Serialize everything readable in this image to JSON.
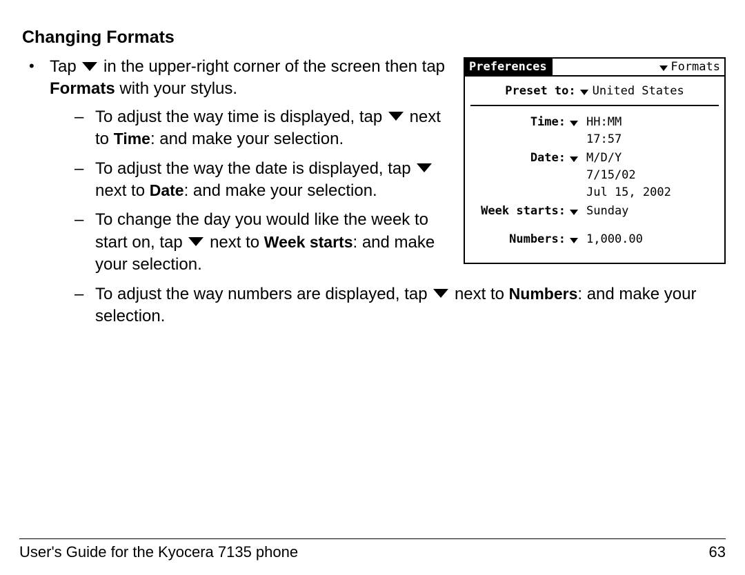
{
  "heading": "Changing Formats",
  "bullet1": {
    "pre": "Tap ",
    "post": " in the upper-right corner of the screen then tap ",
    "formats_word": "Formats",
    "tail": " with your stylus."
  },
  "dash1": {
    "pre": "To adjust the way time is displayed, tap ",
    "post": " next to ",
    "label": "Time",
    "tail": ": and make your selection."
  },
  "dash2": {
    "pre": "To adjust the way the date is displayed, tap ",
    "post": " next to ",
    "label": "Date",
    "tail": ": and make your selection."
  },
  "dash3": {
    "pre": "To change the day you would like the week to start on, tap ",
    "post": " next to ",
    "label": "Week starts",
    "tail": ": and make your selection."
  },
  "dash4": {
    "pre": "To adjust the way numbers are displayed, tap ",
    "post": " next to ",
    "label": "Numbers",
    "tail": ": and make your selection."
  },
  "palm": {
    "title": "Preferences",
    "menu": "Formats",
    "preset_label": "Preset to:",
    "preset_value": "United States",
    "time_label": "Time:",
    "time_value": "HH:MM",
    "time_example": "17:57",
    "date_label": "Date:",
    "date_value": "M/D/Y",
    "date_ex1": "7/15/02",
    "date_ex2": "Jul 15, 2002",
    "week_label": "Week starts:",
    "week_value": "Sunday",
    "numbers_label": "Numbers:",
    "numbers_value": "1,000.00"
  },
  "footer_left": "User's Guide for the Kyocera 7135 phone",
  "footer_right": "63"
}
